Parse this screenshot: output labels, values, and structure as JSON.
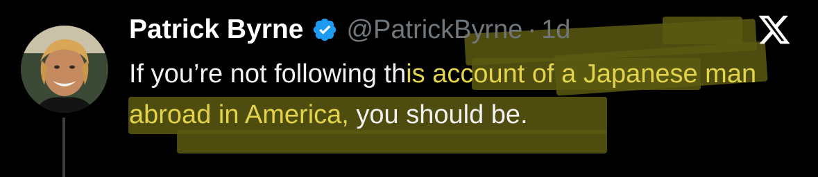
{
  "tweet": {
    "author_name": "Patrick Byrne",
    "handle": "@PatrickByrne",
    "separator": "·",
    "time": "1d",
    "text_before": "If you’re not following th",
    "text_highlight": "is account of a Japanese man abroad in America,",
    "text_after": " you should be."
  },
  "icons": {
    "verified": "verified-badge-icon",
    "platform": "x-logo-icon"
  },
  "colors": {
    "background": "#000000",
    "verified_blue": "#1d9bf0",
    "muted": "#71767b",
    "highlight_text": "#e2d34c",
    "highlight_marker": "#5c5a12"
  }
}
